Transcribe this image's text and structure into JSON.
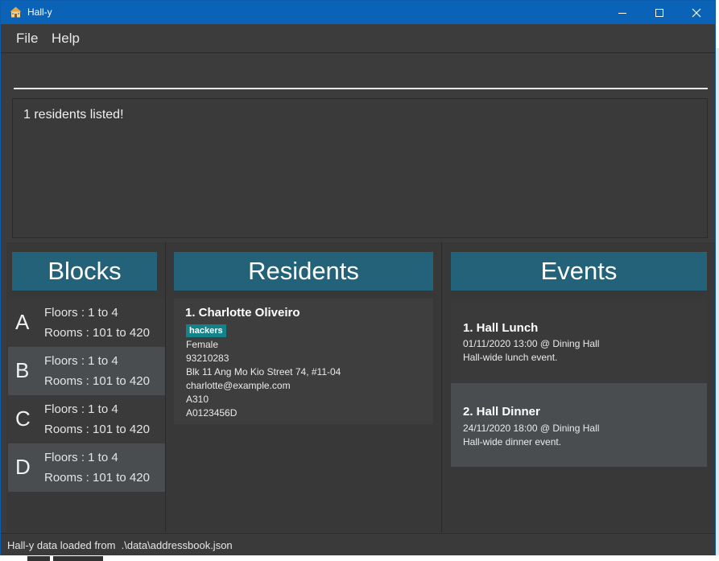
{
  "window": {
    "title": "Hall-y"
  },
  "menu": {
    "file": "File",
    "help": "Help"
  },
  "command": {
    "value": ""
  },
  "result": {
    "text": "1 residents listed!"
  },
  "panels": {
    "blocks_title": "Blocks",
    "residents_title": "Residents",
    "events_title": "Events"
  },
  "blocks": [
    {
      "letter": "A",
      "floors": "Floors : 1 to 4",
      "rooms": "Rooms : 101 to 420"
    },
    {
      "letter": "B",
      "floors": "Floors : 1 to 4",
      "rooms": "Rooms : 101 to 420"
    },
    {
      "letter": "C",
      "floors": "Floors : 1 to 4",
      "rooms": "Rooms : 101 to 420"
    },
    {
      "letter": "D",
      "floors": "Floors : 1 to 4",
      "rooms": "Rooms : 101 to 420"
    }
  ],
  "residents": [
    {
      "name": "1.  Charlotte Oliveiro",
      "tag": "hackers",
      "gender": "Female",
      "phone": "93210283",
      "address": "Blk 11 Ang Mo Kio Street 74, #11-04",
      "email": "charlotte@example.com",
      "room": "A310",
      "matric": "A0123456D"
    }
  ],
  "events": [
    {
      "name": "1.  Hall Lunch",
      "datetime": "01/11/2020 13:00 @ Dining Hall",
      "description": "Hall-wide lunch event."
    },
    {
      "name": "2.  Hall Dinner",
      "datetime": "24/11/2020 18:00 @ Dining Hall",
      "description": "Hall-wide dinner event."
    }
  ],
  "status": {
    "text": "Hall-y data loaded from  .\\data\\addressbook.json"
  },
  "colors": {
    "titlebar": "#0b63b8",
    "header": "#24627a",
    "tag": "#138389",
    "selected_row": "#4a4d4f"
  }
}
